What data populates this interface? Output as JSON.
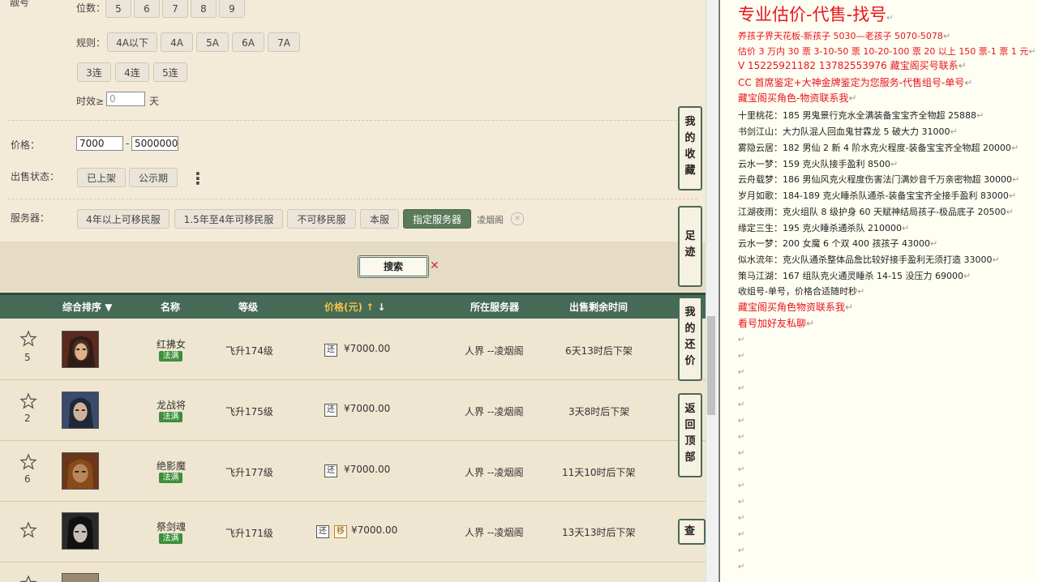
{
  "filters": {
    "top_label": "靓号",
    "digits_label": "位数：",
    "digits": [
      "5",
      "6",
      "7",
      "8",
      "9"
    ],
    "rule_label": "规则：",
    "rules_row1": [
      "4A以下",
      "4A",
      "5A",
      "6A",
      "7A"
    ],
    "rules_row2": [
      "3连",
      "4连",
      "5连"
    ],
    "validity_label": "时效≥",
    "validity_value": "0",
    "validity_unit": "天",
    "price_label": "价格：",
    "price_min": "7000",
    "price_sep": "-",
    "price_max": "5000000",
    "status_label": "出售状态：",
    "status_options": [
      "已上架",
      "公示期"
    ],
    "more_glyph": "⋮",
    "server_label": "服务器：",
    "server_options": [
      "4年以上可移民服",
      "1.5年至4年可移民服",
      "不可移民服",
      "本服",
      "指定服务器"
    ],
    "selected_server": "凌烟阁",
    "clear_glyph": "✕"
  },
  "search": {
    "label": "搜索",
    "x_glyph": "✕"
  },
  "table": {
    "headers": {
      "sort": "综合排序",
      "name": "名称",
      "level": "等级",
      "price": "价格(元)",
      "server": "所在服务器",
      "time": "出售剩余时间"
    },
    "rows": [
      {
        "rank": "5",
        "name": "红拂女",
        "badge": "法满",
        "level": "飞升174级",
        "tags": [
          "还"
        ],
        "price": "¥7000.00",
        "server": "人界 --凌烟阁",
        "time": "6天13时后下架",
        "avatar_color": "#7a3a2a"
      },
      {
        "rank": "2",
        "name": "龙战将",
        "badge": "法满",
        "level": "飞升175级",
        "tags": [
          "还"
        ],
        "price": "¥7000.00",
        "server": "人界 --凌烟阁",
        "time": "3天8时后下架",
        "avatar_color": "#4a5a7a"
      },
      {
        "rank": "6",
        "name": "绝影魔",
        "badge": "法满",
        "level": "飞升177级",
        "tags": [
          "还"
        ],
        "price": "¥7000.00",
        "server": "人界 --凌烟阁",
        "time": "11天10时后下架",
        "avatar_color": "#6a3a1a"
      },
      {
        "rank": "",
        "name": "祭剑魂",
        "badge": "法满",
        "level": "飞升171级",
        "tags": [
          "还",
          "移"
        ],
        "price": "¥7000.00",
        "server": "人界 --凌烟阁",
        "time": "13天13时后下架",
        "avatar_color": "#3a3a3a"
      }
    ]
  },
  "float_buttons": {
    "favorites": [
      "我",
      "的",
      "收",
      "藏"
    ],
    "footprints": [
      "足",
      "迹"
    ],
    "offers": [
      "我",
      "的",
      "还",
      "价"
    ],
    "back_top": [
      "返",
      "回",
      "顶",
      "部"
    ],
    "view_partial": "查"
  },
  "notes": {
    "title": "专业估价-代售-找号",
    "lines": [
      "养孩子界天花板-新孩子 5030—老孩子 5070-5078",
      "估价 3 万内 30 票  3-10-50 票  10-20-100 票  20 以上 150 票-1 票 1 元",
      "V 15225921182      13782553976    藏宝阁买号联系",
      "CC 首席鉴定+大神金牌鉴定为您服务-代售组号-单号",
      "藏宝阁买角色-物资联系我",
      "十里桃花：185 男鬼景行克水全满装备宝宝齐全物超 25888",
      "书剑江山：大力队混人回血鬼甘霖龙 5 破大力 31000",
      "雾隐云居：182 男仙 2 新 4 阶水克火程度-装备宝宝齐全物超 20000",
      "云水一梦：159 克火队接手盈利 8500",
      "云舟载梦：186 男仙风克火程度伤害法门满妙音千万亲密物超 30000",
      "岁月如歌：184-189 克火睡杀队通杀-装备宝宝齐全接手盈利 83000",
      "江湖夜雨：克火组队 8 级护身 60 天赋神结局孩子-极品底子 20500",
      "缘定三生：195 克火睡杀通杀队 210000",
      "云水一梦：200 女魔 6 个双 400 孩孩子 43000",
      "似水流年：克火队通杀整体品詹比较好接手盈利无须打造 33000",
      "策马江湖：167 组队克火通灵睡杀 14-15 没压力 69000",
      "收组号-单号，价格合适随时秒",
      "藏宝阁买角色物资联系我",
      "看号加好友私聊"
    ],
    "return_mark": "↵"
  },
  "colors": {
    "red_text": "#e8141a",
    "table_header": "#456a55",
    "active_button": "#5a7a5a",
    "badge_green": "#3d8f3a"
  }
}
